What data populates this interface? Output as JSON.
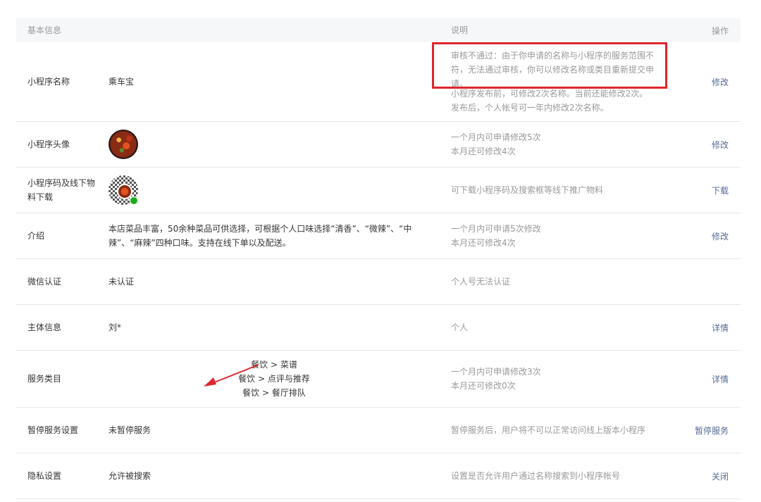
{
  "header": {
    "basic": "基本信息",
    "desc": "说明",
    "action": "操作"
  },
  "rows": {
    "name": {
      "label": "小程序名称",
      "value": "乘车宝",
      "warning": "审核不通过：由于你申请的名称与小程序的服务范围不符，无法通过审核，你可以修改名称或类目重新提交申请。",
      "desc1": "小程序发布前，可修改2次名称。当前还能修改2次。",
      "desc2": "发布后，个人帐号可一年内修改2次名称。",
      "action": "修改"
    },
    "avatar": {
      "label": "小程序头像",
      "desc1": "一个月内可申请修改5次",
      "desc2": "本月还可修改4次",
      "action": "修改"
    },
    "qrcode": {
      "label": "小程序码及线下物料下载",
      "desc": "可下载小程序码及搜索框等线下推广物料",
      "action": "下载"
    },
    "intro": {
      "label": "介绍",
      "value": "本店菜品丰富，50余种菜品可供选择，可根据个人口味选择“清香”、“微辣”、“中辣”、“麻辣”四种口味。支持在线下单以及配送。",
      "desc1": "一个月内可申请5次修改",
      "desc2": "本月还可修改4次",
      "action": "修改"
    },
    "wechat_auth": {
      "label": "微信认证",
      "value": "未认证",
      "desc": "个人号无法认证"
    },
    "entity": {
      "label": "主体信息",
      "value": "刘*",
      "desc": "个人",
      "action": "详情"
    },
    "category": {
      "label": "服务类目",
      "items": [
        "餐饮 > 菜谱",
        "餐饮 > 点评与推荐",
        "餐饮 > 餐厅排队"
      ],
      "desc1": "一个月内可申请修改3次",
      "desc2": "本月还可修改0次",
      "action": "详情"
    },
    "pause": {
      "label": "暂停服务设置",
      "value": "未暂停服务",
      "desc": "暂停服务后，用户将不可以正常访问线上版本小程序",
      "action": "暂停服务"
    },
    "privacy": {
      "label": "隐私设置",
      "value": "允许被搜索",
      "desc": "设置是否允许用户通过名称搜索到小程序帐号",
      "action": "关闭"
    }
  },
  "colors": {
    "link": "#576b95",
    "warning_border": "#e0262e",
    "arrow": "#e0262e",
    "muted": "#9a9a9a"
  }
}
